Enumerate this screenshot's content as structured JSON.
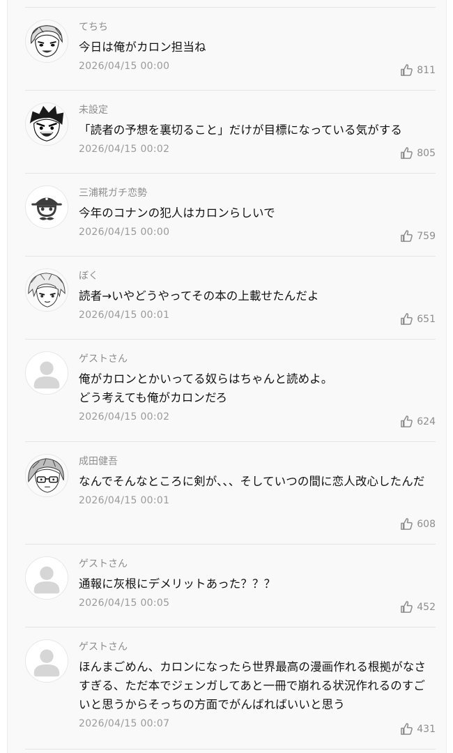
{
  "comments": [
    {
      "author": "てちち",
      "text": "今日は俺がカロン担当ね",
      "time": "2026/04/15 00:00",
      "likes": "811",
      "avatar_icon": "manga-smiling-girl-icon"
    },
    {
      "author": "未設定",
      "text": "「読者の予想を裏切ること」だけが目標になっている気がする",
      "time": "2026/04/15 00:02",
      "likes": "805",
      "avatar_icon": "manga-shouting-boy-icon"
    },
    {
      "author": "三浦糀ガチ恋勢",
      "text": "今年のコナンの犯人はカロンらしいで",
      "time": "2026/04/15 00:00",
      "likes": "759",
      "avatar_icon": "pirate-skull-logo-icon"
    },
    {
      "author": "ぼく",
      "text": "読者→いやどうやってその本の上載せたんだよ",
      "time": "2026/04/15 00:01",
      "likes": "651",
      "avatar_icon": "manga-silver-hair-character-icon"
    },
    {
      "author": "ゲストさん",
      "text": "俺がカロンとかいってる奴らはちゃんと読めよ。どう考えても俺がカロンだろ",
      "time": "2026/04/15 00:02",
      "likes": "624",
      "avatar_icon": "default-user-icon"
    },
    {
      "author": "成田健吾",
      "text": "なんでそんなところに剣が、、、そしていつの間に恋人改心したんだ",
      "time": "2026/04/15 00:01",
      "likes": "608",
      "avatar_icon": "manga-glasses-character-icon"
    },
    {
      "author": "ゲストさん",
      "text": "通報に灰根にデメリットあった？？？",
      "time": "2026/04/15 00:05",
      "likes": "452",
      "avatar_icon": "default-user-icon"
    },
    {
      "author": "ゲストさん",
      "text": "ほんまごめん、カロンになったら世界最高の漫画作れる根拠がなさすぎる、ただ本でジェンガしてあと一冊で崩れる状況作れるのすごいと思うからそっちの方面でがんばればいいと思う",
      "time": "2026/04/15 00:07",
      "likes": "431",
      "avatar_icon": "default-user-icon"
    }
  ],
  "like_icon": "thumbs-up-icon"
}
